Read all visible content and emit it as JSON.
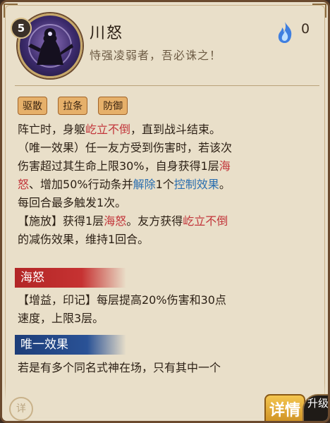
{
  "header": {
    "level": "5",
    "skill_name": "川怒",
    "quote": "恃强凌弱者，吾必诛之！",
    "cost": "0",
    "cost_icon": "blue-soul-fire-icon"
  },
  "tags": [
    "驱散",
    "拉条",
    "防御"
  ],
  "description": {
    "line1_a": "阵亡时，身躯",
    "line1_red": "屹立不倒",
    "line1_b": "，直到战斗结束。",
    "line2_a": "（唯一效果）任一友方受到伤害时，若该次",
    "line3_a": "伤害超过其生命上限30%，自身获得1层",
    "line3_red": "海",
    "line4_red": "怒",
    "line4_a": "、增加50%行动条并",
    "line4_blue1": "解除",
    "line4_b": "1个",
    "line4_blue2": "控制效果",
    "line4_c": "。",
    "line5_a": "每回合最多触发1次。",
    "line6_a": "【施放】获得1层",
    "line6_red": "海怒",
    "line6_b": "。友方获得",
    "line6_red2": "屹立不倒",
    "line7_a": "的减伤效果，维持1回合。"
  },
  "section_haonu": {
    "title": "海怒",
    "line1": "【增益，印记】每层提高20%伤害和30点",
    "line2": "速度，上限3层。"
  },
  "section_unique": {
    "title": "唯一效果",
    "line1": "若是有多个同名式神在场，只有其中一个"
  },
  "buttons": {
    "detail_small": "详",
    "detail_big": "详情",
    "upgrade": "升级"
  },
  "colors": {
    "keyword_red": "#c2353a",
    "keyword_blue": "#2b6fb0",
    "tag_bg": "#e6b06a",
    "band_red": "#b22626",
    "band_blue": "#1d3d78"
  }
}
